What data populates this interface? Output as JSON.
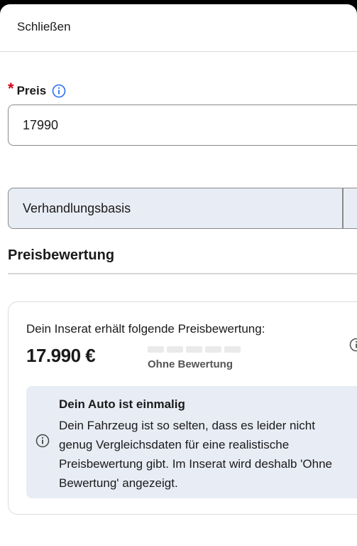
{
  "header": {
    "close_label": "Schließen"
  },
  "price": {
    "required_mark": "*",
    "label": "Preis",
    "value": "17990"
  },
  "negotiable": {
    "label": "Verhandlungsbasis"
  },
  "rating_section": {
    "title": "Preisbewertung",
    "intro": "Dein Inserat erhält folgende Preisbewertung:",
    "price_display": "17.990 €",
    "rating_label": "Ohne Bewertung",
    "rating_level": 0,
    "rating_segments": 5
  },
  "info_box": {
    "title": "Dein Auto ist einmalig",
    "body": "Dein Fahrzeug ist so selten, dass es leider nicht genug Vergleichsdaten für eine realistische Preisbewertung gibt. Im Inserat wird deshalb 'Ohne Bewertung' angezeigt."
  },
  "colors": {
    "required": "#d0021b",
    "info_blue": "#2a6df4",
    "field_background": "#e8ecf4",
    "sheet_background": "#ffffff"
  },
  "icons": {
    "price_info": "info-icon",
    "rating_info": "info-icon",
    "box_info": "info-icon"
  }
}
